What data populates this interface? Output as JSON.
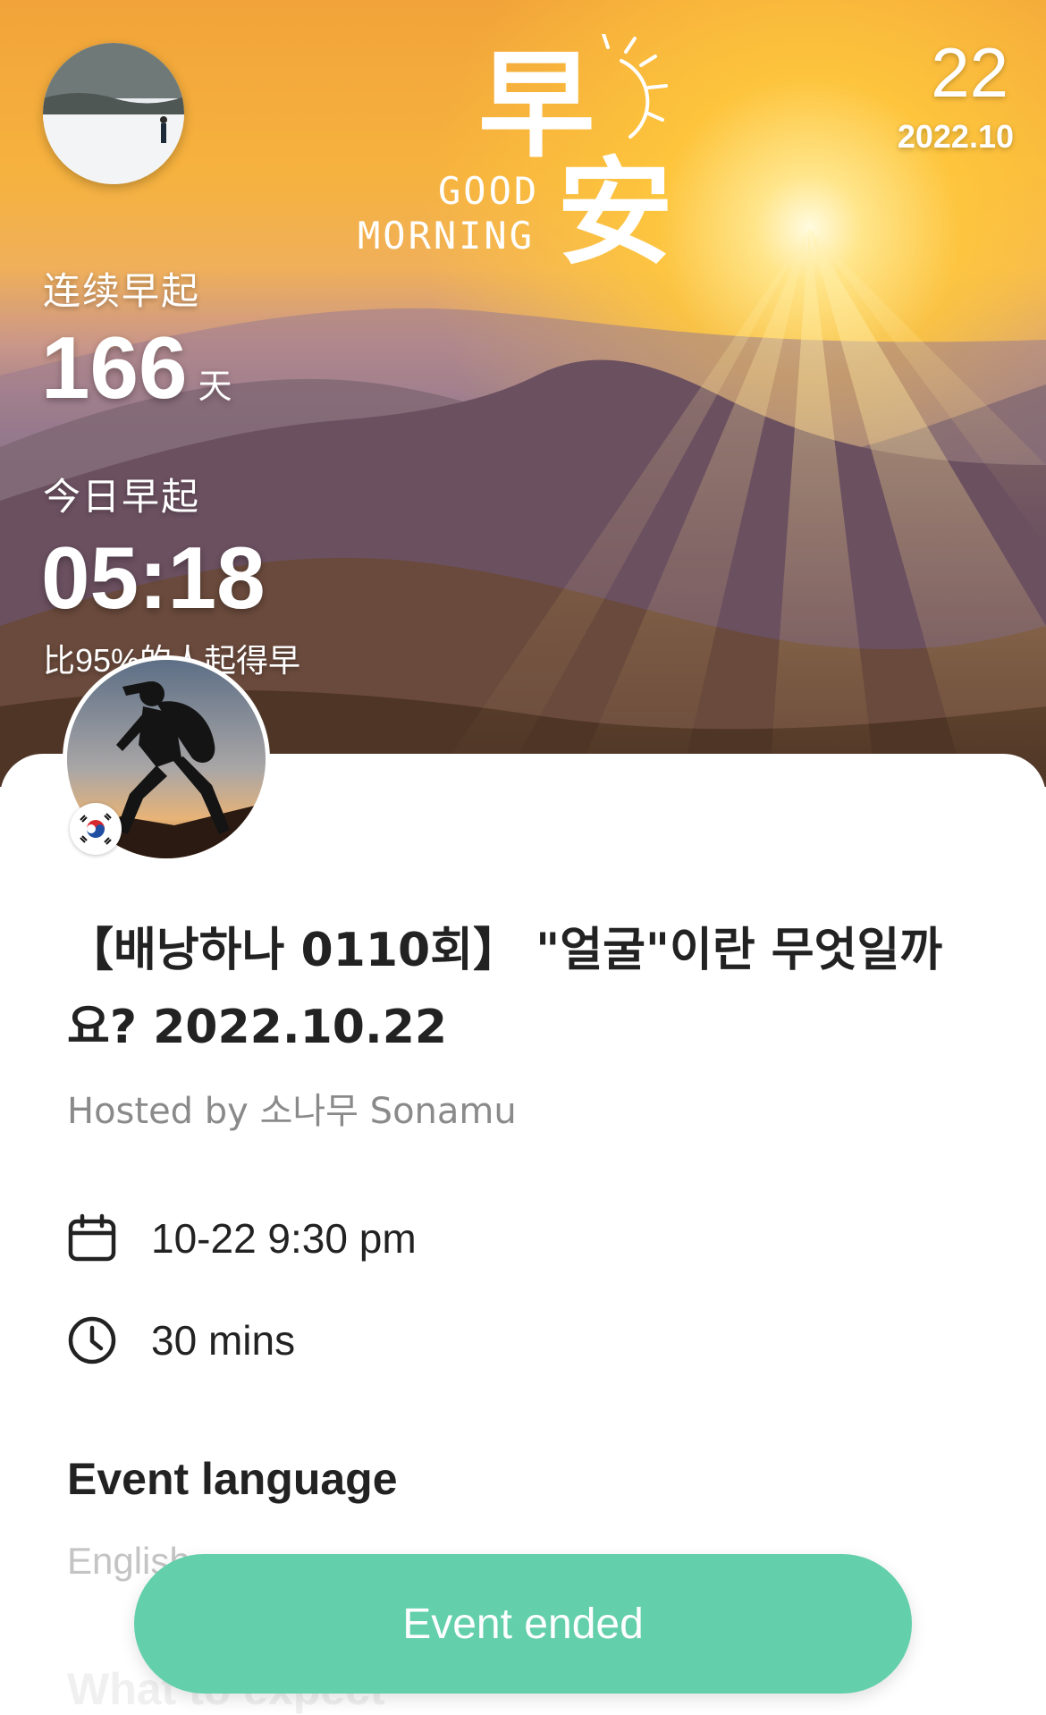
{
  "hero": {
    "logo_char_top": "早",
    "logo_char_bottom": "安",
    "logo_en_line1": "GOOD",
    "logo_en_line2": "MORNING",
    "date_day": "22",
    "date_year_month": "2022.10",
    "streak_label": "连续早起",
    "streak_value": "166",
    "streak_unit": "天",
    "today_label": "今日早起",
    "today_time": "05:18",
    "compare_text": "比95%的人起得早"
  },
  "event": {
    "title": "【배낭하나 0110회】 \"얼굴\"이란 무엇일까요? 2022.10.22",
    "hosted_by": "Hosted by 소나무 Sonamu",
    "datetime": "10-22 9:30 pm",
    "duration": "30 mins",
    "language_heading": "Event language",
    "language_value": "English",
    "expect_heading": "What to expect",
    "status_button": "Event ended"
  },
  "icons": {
    "calendar": "calendar-icon",
    "clock": "clock-icon",
    "flag": "korea-flag-icon"
  },
  "colors": {
    "accent": "#63cfab",
    "title_text": "#222222",
    "muted_text": "#8a8a8a"
  }
}
